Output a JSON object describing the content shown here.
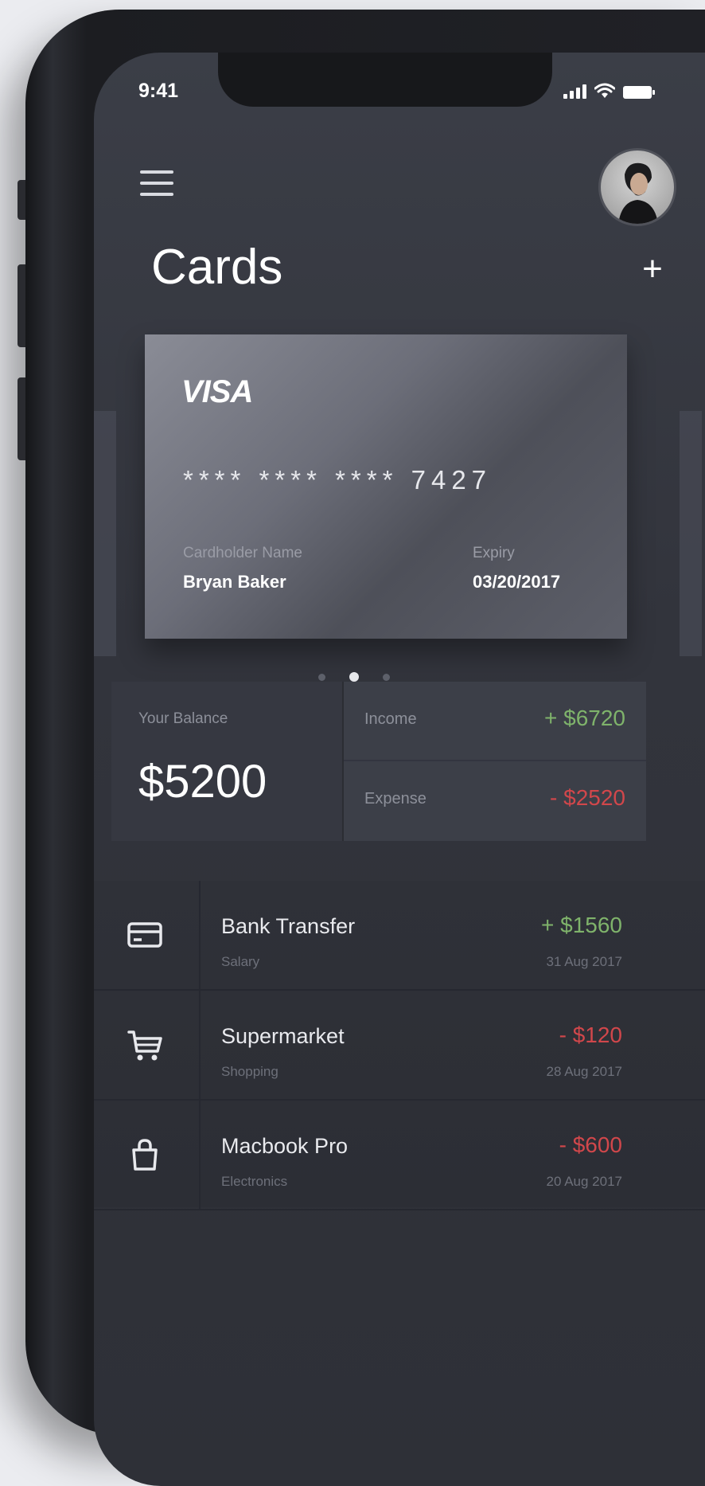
{
  "status_bar": {
    "time": "9:41"
  },
  "header": {
    "title": "Cards",
    "add_label": "+"
  },
  "card": {
    "brand": "VISA",
    "number": "**** **** **** 7427",
    "cardholder_label": "Cardholder Name",
    "cardholder_name": "Bryan Baker",
    "expiry_label": "Expiry",
    "expiry_value": "03/20/2017"
  },
  "pager": {
    "count": 3,
    "active_index": 1
  },
  "balance": {
    "label": "Your Balance",
    "value": "$5200",
    "income_label": "Income",
    "income_value": "+ $6720",
    "expense_label": "Expense",
    "expense_value": "- $2520"
  },
  "transactions": [
    {
      "icon": "credit-card-icon",
      "title": "Bank Transfer",
      "category": "Salary",
      "amount": "+ $1560",
      "date": "31 Aug 2017",
      "type": "income"
    },
    {
      "icon": "shopping-cart-icon",
      "title": "Supermarket",
      "category": "Shopping",
      "amount": "- $120",
      "date": "28 Aug 2017",
      "type": "expense"
    },
    {
      "icon": "shopping-bag-icon",
      "title": "Macbook Pro",
      "category": "Electronics",
      "amount": "- $600",
      "date": "20 Aug 2017",
      "type": "expense"
    }
  ],
  "colors": {
    "income": "#7fb36b",
    "expense": "#d1474b",
    "background": "#32343c"
  }
}
